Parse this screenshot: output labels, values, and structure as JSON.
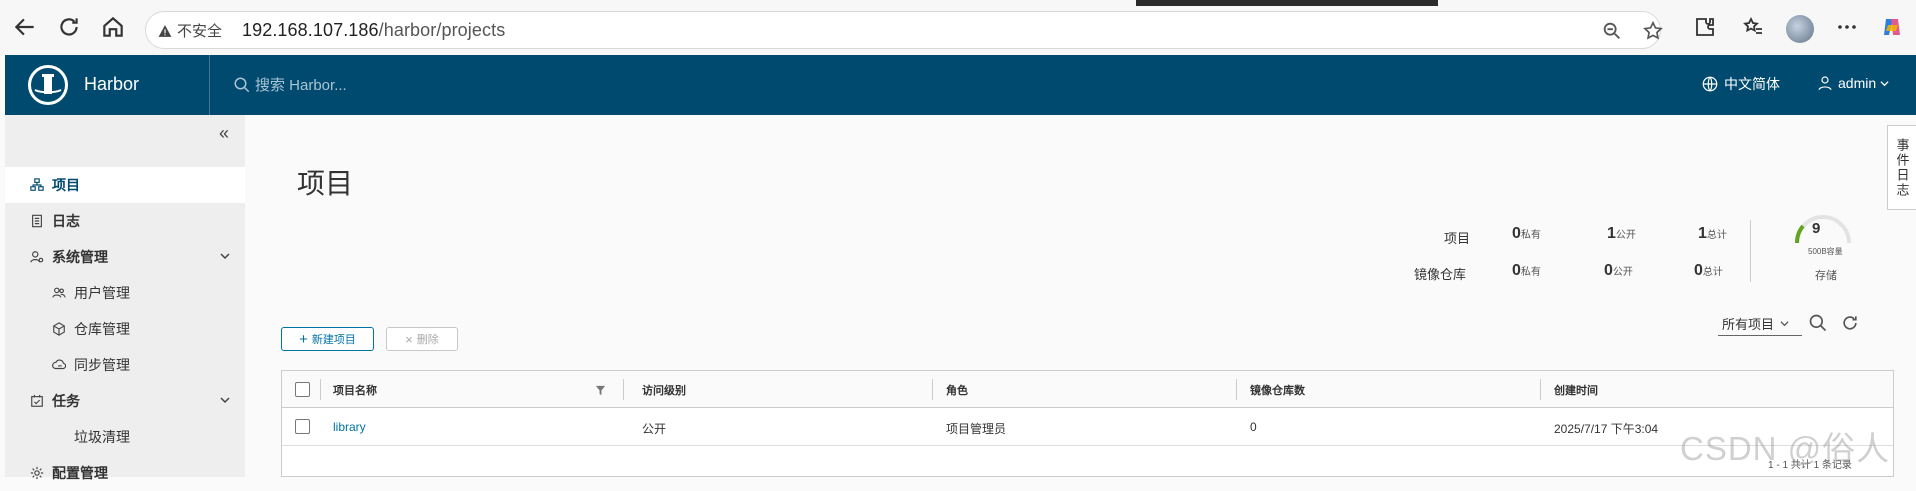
{
  "browser": {
    "security_label": "不安全",
    "url_host": "192.168.107.186",
    "url_path": "/harbor/projects"
  },
  "header": {
    "brand": "Harbor",
    "search_placeholder": "搜索 Harbor...",
    "language": "中文简体",
    "user": "admin"
  },
  "sidebar": {
    "items": [
      {
        "label": "项目",
        "icon": "projects-icon"
      },
      {
        "label": "日志",
        "icon": "logs-icon"
      },
      {
        "label": "系统管理",
        "icon": "admin-icon"
      },
      {
        "label": "用户管理",
        "icon": "users-icon"
      },
      {
        "label": "仓库管理",
        "icon": "registry-icon"
      },
      {
        "label": "同步管理",
        "icon": "replication-icon"
      },
      {
        "label": "任务",
        "icon": "tasks-icon"
      },
      {
        "label": "垃圾清理",
        "icon": ""
      },
      {
        "label": "配置管理",
        "icon": "config-icon"
      }
    ]
  },
  "page": {
    "title": "项目",
    "event_log_tab": "事件日志"
  },
  "summary": {
    "projects_label": "项目",
    "repos_label": "镜像仓库",
    "private_label": "私有",
    "public_label": "公开",
    "total_label": "总计",
    "projects": {
      "private": "0",
      "public": "1",
      "total": "1"
    },
    "repos": {
      "private": "0",
      "public": "0",
      "total": "0"
    },
    "storage_value": "9",
    "storage_quota": "500B容量",
    "storage_label": "存储"
  },
  "toolbar": {
    "new_project": "新建项目",
    "delete": "删除",
    "filter": "所有项目"
  },
  "table": {
    "headers": [
      "项目名称",
      "访问级别",
      "角色",
      "镜像仓库数",
      "创建时间"
    ],
    "rows": [
      {
        "name": "library",
        "access": "公开",
        "role": "项目管理员",
        "repo_count": "0",
        "created": "2025/7/17 下午3:04"
      }
    ],
    "footer": "1 - 1 共计 1 条记录"
  },
  "watermark": "CSDN @俗人",
  "colors": {
    "header_bg": "#004a70",
    "accent": "#0072a3",
    "gauge_green": "#62a420"
  }
}
